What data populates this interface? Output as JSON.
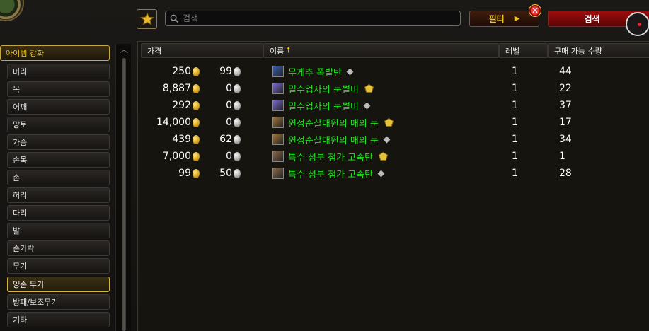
{
  "toolbar": {
    "search_placeholder": "검색",
    "filter_label": "필터",
    "search_button": "검색"
  },
  "sidebar": {
    "items": [
      {
        "label": "아이템 강화",
        "state": "header"
      },
      {
        "label": "머리"
      },
      {
        "label": "목"
      },
      {
        "label": "어깨"
      },
      {
        "label": "망토"
      },
      {
        "label": "가슴"
      },
      {
        "label": "손목"
      },
      {
        "label": "손"
      },
      {
        "label": "허리"
      },
      {
        "label": "다리"
      },
      {
        "label": "발"
      },
      {
        "label": "손가락"
      },
      {
        "label": "무기"
      },
      {
        "label": "양손 무기",
        "state": "selected"
      },
      {
        "label": "방패/보조무기"
      },
      {
        "label": "기타"
      }
    ]
  },
  "table": {
    "headers": {
      "price": "가격",
      "name": "이름",
      "level": "레벨",
      "available": "구매 가능 수량"
    },
    "rows": [
      {
        "gold": "250",
        "silver": "99",
        "name": "무게추 폭발탄",
        "quality": "silver",
        "icon": "bomb-icon",
        "icon_color": "#3a5fb0",
        "level": "1",
        "qty": "44"
      },
      {
        "gold": "8,887",
        "silver": "0",
        "name": "밀수업자의 눈썰미",
        "quality": "gold",
        "icon": "scope-icon",
        "icon_color": "#7a6ad0",
        "level": "1",
        "qty": "22"
      },
      {
        "gold": "292",
        "silver": "0",
        "name": "밀수업자의 눈썰미",
        "quality": "silver",
        "icon": "scope-icon",
        "icon_color": "#7a6ad0",
        "level": "1",
        "qty": "37"
      },
      {
        "gold": "14,000",
        "silver": "0",
        "name": "원정순찰대원의 매의 눈",
        "quality": "gold",
        "icon": "hawkeye-icon",
        "icon_color": "#a0743a",
        "level": "1",
        "qty": "17"
      },
      {
        "gold": "439",
        "silver": "62",
        "name": "원정순찰대원의 매의 눈",
        "quality": "silver",
        "icon": "hawkeye-icon",
        "icon_color": "#a0743a",
        "level": "1",
        "qty": "34"
      },
      {
        "gold": "7,000",
        "silver": "0",
        "name": "특수 성분 첨가 고속탄",
        "quality": "gold",
        "icon": "bullet-icon",
        "icon_color": "#8a6a4a",
        "level": "1",
        "qty": "1"
      },
      {
        "gold": "99",
        "silver": "50",
        "name": "특수 성분 첨가 고속탄",
        "quality": "silver",
        "icon": "bullet-icon",
        "icon_color": "#8a6a4a",
        "level": "1",
        "qty": "28"
      }
    ]
  },
  "colors": {
    "accent_gold": "#f5c518",
    "item_green": "#21e321",
    "search_red": "#9e0d0d"
  }
}
